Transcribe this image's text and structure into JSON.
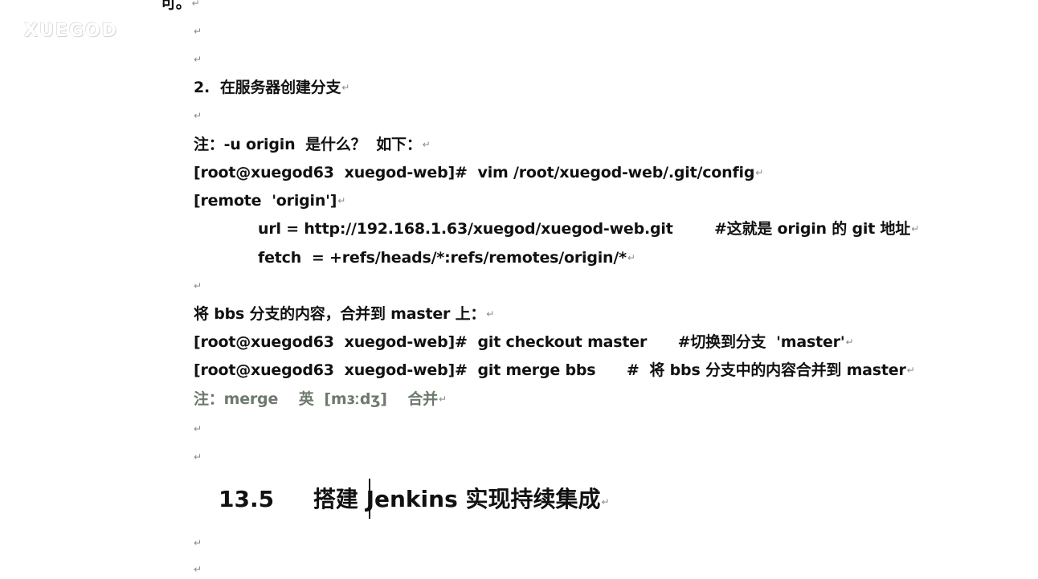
{
  "watermark": "XUEGOD",
  "paragraph_mark": "↵",
  "lines": [
    {
      "text": "可。"
    },
    {
      "text": ""
    },
    {
      "text": ""
    },
    {
      "text": "2.  在服务器创建分支"
    },
    {
      "text": ""
    },
    {
      "text": "注：-u origin  是什么？  如下："
    },
    {
      "text": "[root@xuegod63  xuegod-web]#  vim /root/xuegod-web/.git/config"
    },
    {
      "text": "[remote  'origin']"
    },
    {
      "text": "url = http://192.168.1.63/xuegod/xuegod-web.git        #这就是 origin 的 git 地址"
    },
    {
      "text": "fetch  = +refs/heads/*:refs/remotes/origin/*"
    },
    {
      "text": ""
    },
    {
      "text": "将 bbs 分支的内容，合并到 master 上："
    },
    {
      "text": "[root@xuegod63  xuegod-web]#  git checkout master      #切换到分支  'master'"
    },
    {
      "text": "[root@xuegod63  xuegod-web]#  git merge bbs      #  将 bbs 分支中的内容合并到 master"
    },
    {
      "text": "注：merge    英  [mɜːdʒ]    合并"
    },
    {
      "text": ""
    },
    {
      "text": ""
    },
    {
      "text": "13.5     搭建 Jenkins 实现持续集成"
    },
    {
      "text": ""
    },
    {
      "text": ""
    }
  ]
}
